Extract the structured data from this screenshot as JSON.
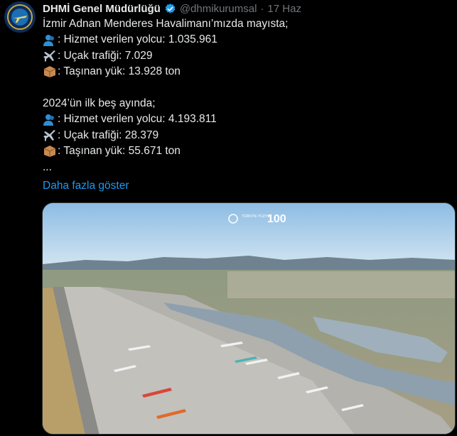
{
  "account": {
    "display_name": "DHMİ Genel Müdürlüğü",
    "handle": "@dhmikurumsal",
    "separator": "·",
    "timestamp": "17 Haz",
    "verified": true,
    "avatar_icon": "dhmi-emblem-avatar"
  },
  "tweet": {
    "intro": "İzmir Adnan Menderes Havalimanı’mızda mayısta;",
    "may_stats": [
      {
        "icon": "passenger-icon",
        "text": ": Hizmet verilen yolcu: 1.035.961"
      },
      {
        "icon": "airplane-icon",
        "text": ": Uçak trafiği: 7.029"
      },
      {
        "icon": "package-icon",
        "text": ": Taşınan yük: 13.928 ton"
      }
    ],
    "period_heading": "2024’ün ilk beş ayında;",
    "ytd_stats": [
      {
        "icon": "passenger-icon",
        "text": ": Hizmet verilen yolcu: 4.193.811"
      },
      {
        "icon": "airplane-icon",
        "text": ": Uçak trafiği: 28.379"
      },
      {
        "icon": "package-icon",
        "text": ": Taşınan yük: 55.671 ton"
      }
    ],
    "ellipsis": "...",
    "show_more": "Daha fazla göster"
  },
  "media": {
    "description_icon": "airport-aerial-photo",
    "watermark_left": "TÜRKİYE YÜZYILI",
    "watermark_right": "100",
    "colors": {
      "sky": "#a9cde9",
      "apron": "#b9b8b3",
      "terminal_roof": "#8aa0b0"
    }
  },
  "colors": {
    "background": "#000000",
    "text": "#e7e9ea",
    "muted": "#71767b",
    "link": "#1d9bf0",
    "verified": "#1d9bf0"
  }
}
